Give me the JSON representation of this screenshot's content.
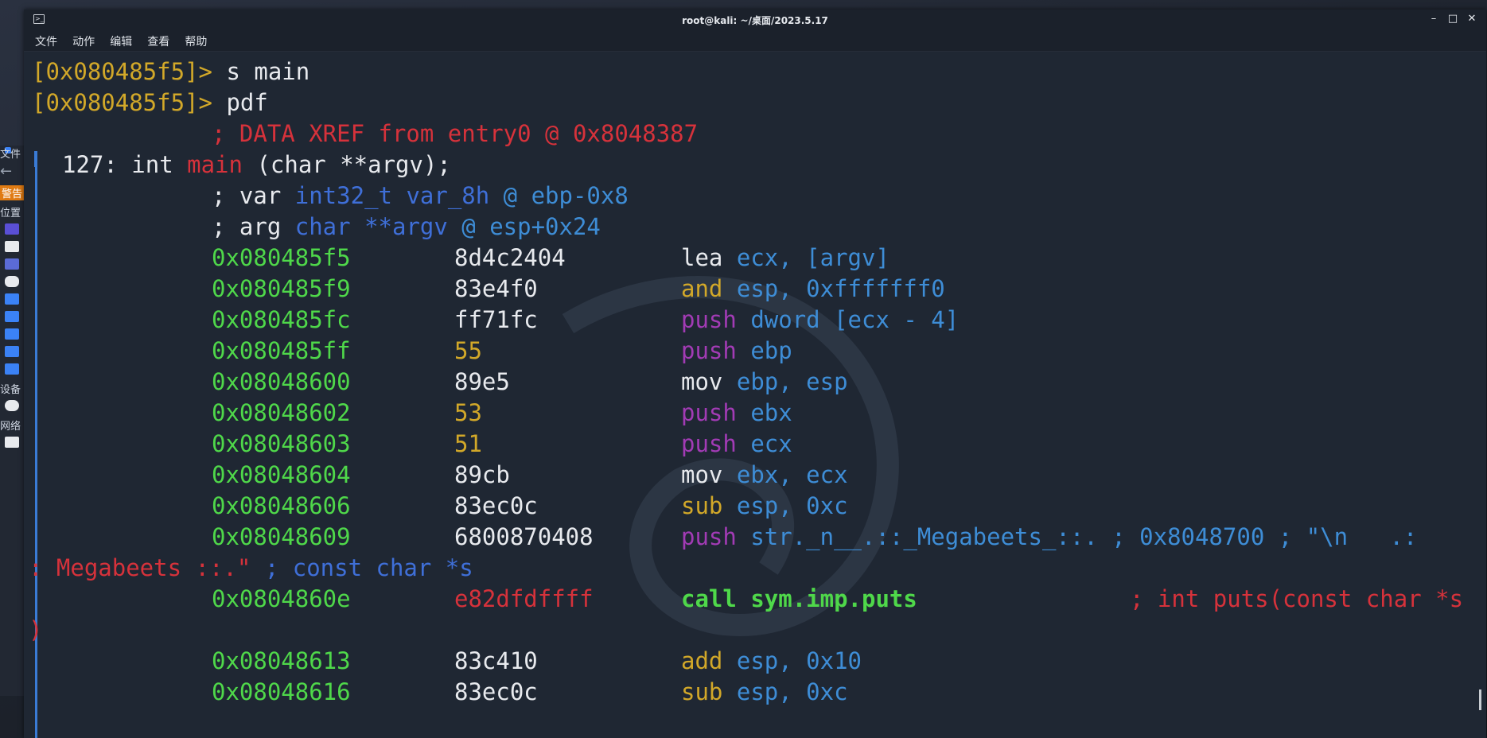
{
  "window": {
    "title": "root@kali: ~/桌面/2023.5.17",
    "min_label": "–",
    "max_label": "□",
    "close_label": "✕"
  },
  "menu": [
    "文件",
    "动作",
    "编辑",
    "查看",
    "帮助"
  ],
  "side_panel": {
    "labels": {
      "files": "文件",
      "warning": "警告",
      "places": "位置",
      "devices": "设备",
      "network": "网络"
    }
  },
  "colors": {
    "prompt": "#d2a829",
    "address": "#4fd84a",
    "comment": "#d6323b",
    "type": "#3f6fd8",
    "register": "#3e8dd6",
    "instruction_push": "#a23bb5",
    "gutter": "#3a7bd5"
  },
  "terminal": {
    "prompt1": {
      "prompt": "[0x080485f5]>",
      "cmd": " s main"
    },
    "prompt2": {
      "prompt": "[0x080485f5]>",
      "cmd": " pdf"
    },
    "xref": "; DATA XREF from entry0 @ 0x8048387",
    "func_sig": {
      "size": "127: int ",
      "name": "main",
      "rest": " (char **argv);"
    },
    "var_line": {
      "pre": "; var ",
      "type": "int32_t var_8h",
      "post": " @ ebp-0x8"
    },
    "arg_line": {
      "pre": "; arg ",
      "type": "char **argv",
      "post": " @ esp+0x24"
    },
    "instructions": [
      {
        "addr": "0x080485f5",
        "bytes": "8d4c2404",
        "op": "lea",
        "args": "ecx, [argv]"
      },
      {
        "addr": "0x080485f9",
        "bytes": "83e4f0",
        "op": "and",
        "args": "esp, 0xfffffff0"
      },
      {
        "addr": "0x080485fc",
        "bytes": "ff71fc",
        "op": "push",
        "args": "dword [ecx - 4]"
      },
      {
        "addr": "0x080485ff",
        "bytes": "55",
        "op": "push",
        "args": "ebp"
      },
      {
        "addr": "0x08048600",
        "bytes": "89e5",
        "op": "mov",
        "args": "ebp, esp"
      },
      {
        "addr": "0x08048602",
        "bytes": "53",
        "op": "push",
        "args": "ebx"
      },
      {
        "addr": "0x08048603",
        "bytes": "51",
        "op": "push",
        "args": "ecx"
      },
      {
        "addr": "0x08048604",
        "bytes": "89cb",
        "op": "mov",
        "args": "ebx, ecx"
      },
      {
        "addr": "0x08048606",
        "bytes": "83ec0c",
        "op": "sub",
        "args": "esp, 0xc"
      },
      {
        "addr": "0x08048609",
        "bytes": "6800870408",
        "op": "push",
        "args": "str._n__.::_Megabeets_::. ; 0x8048700 ; \"\\n   .:"
      },
      {
        "addr": "0x0804860e",
        "bytes": "e82dfdffff",
        "op": "call",
        "args": "sym.imp.puts"
      },
      {
        "addr": "0x08048613",
        "bytes": "83c410",
        "op": "add",
        "args": "esp, 0x10"
      },
      {
        "addr": "0x08048616",
        "bytes": "83ec0c",
        "op": "sub",
        "args": "esp, 0xc"
      }
    ],
    "wrap1": {
      "text": ": Megabeets ::.\"",
      "comment": " ; const char *s"
    },
    "puts_comment": "; int puts(const char *s",
    "wrap2": ")"
  }
}
